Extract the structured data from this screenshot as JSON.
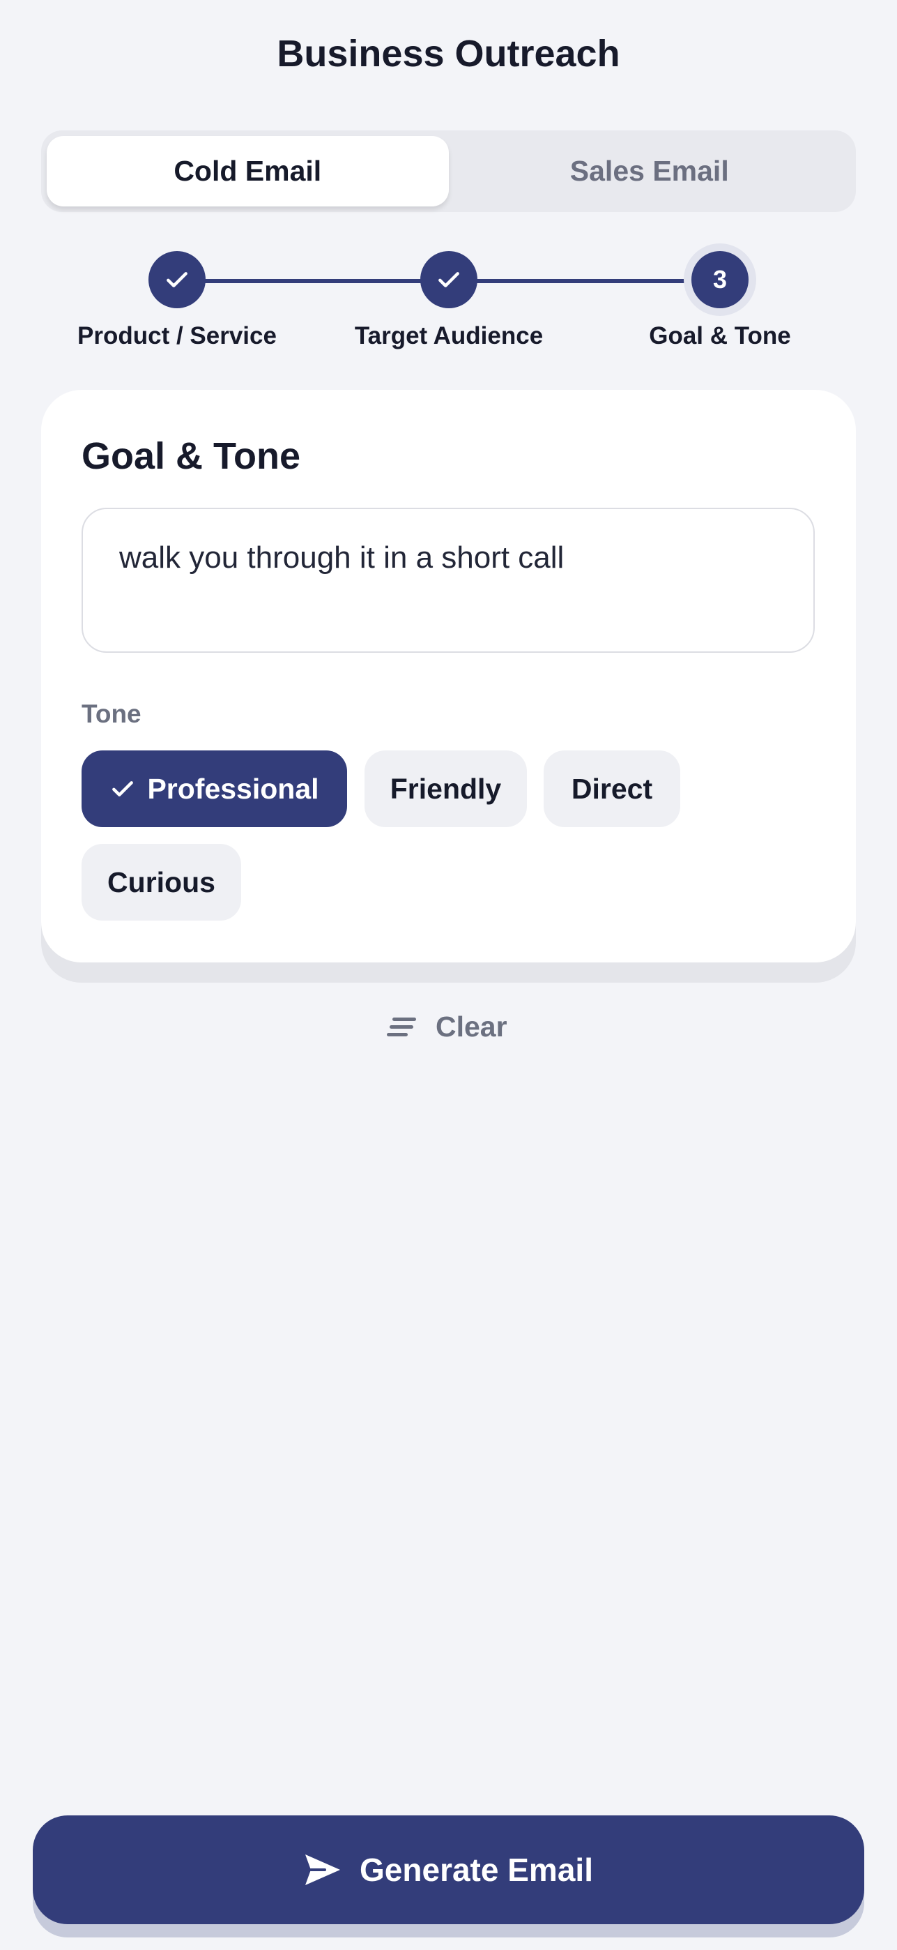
{
  "header": {
    "title": "Business Outreach"
  },
  "tabs": [
    {
      "label": "Cold Email",
      "active": true
    },
    {
      "label": "Sales Email",
      "active": false
    }
  ],
  "steps": [
    {
      "label": "Product / Service",
      "state": "done",
      "icon": "check-icon"
    },
    {
      "label": "Target Audience",
      "state": "done",
      "icon": "check-icon"
    },
    {
      "label": "Goal & Tone",
      "state": "current",
      "number": "3"
    }
  ],
  "card": {
    "title": "Goal & Tone",
    "goal_value": "walk you through it in a short call",
    "tone_label": "Tone",
    "tones": [
      {
        "label": "Professional",
        "selected": true
      },
      {
        "label": "Friendly",
        "selected": false
      },
      {
        "label": "Direct",
        "selected": false
      },
      {
        "label": "Curious",
        "selected": false
      }
    ]
  },
  "actions": {
    "clear_label": "Clear",
    "clear_icon": "lines-icon",
    "generate_label": "Generate Email",
    "generate_icon": "send-icon"
  },
  "colors": {
    "accent": "#333d7a",
    "background": "#f3f4f8",
    "chip": "#eff0f4",
    "muted_text": "#6b7080"
  }
}
